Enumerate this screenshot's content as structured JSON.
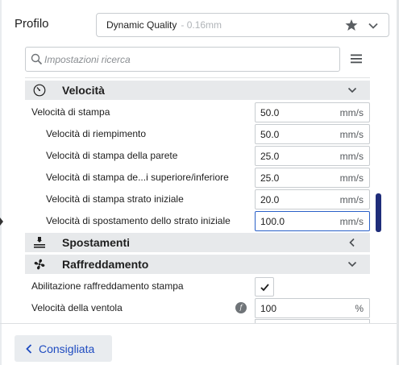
{
  "header": {
    "profile_label": "Profilo",
    "profile_name": "Dynamic Quality",
    "profile_detail": "- 0.16mm",
    "star_icon": "star-icon",
    "dropdown_icon": "chevron-down-icon"
  },
  "search": {
    "placeholder": "Impostazioni ricerca",
    "value": "",
    "menu_icon": "hamburger-menu-icon"
  },
  "categories": {
    "speed": {
      "label": "Velocità",
      "icon": "speedometer-icon",
      "state": "expanded"
    },
    "travel": {
      "label": "Spostamenti",
      "icon": "travel-icon",
      "state": "collapsed"
    },
    "cooling": {
      "label": "Raffreddamento",
      "icon": "fan-icon",
      "state": "expanded"
    }
  },
  "speed_settings": [
    {
      "label": "Velocità di stampa",
      "value": "50.0",
      "unit": "mm/s"
    },
    {
      "label": "Velocità di riempimento",
      "value": "50.0",
      "unit": "mm/s"
    },
    {
      "label": "Velocità di stampa della parete",
      "value": "25.0",
      "unit": "mm/s"
    },
    {
      "label": "Velocità di stampa de...i superiore/inferiore",
      "value": "25.0",
      "unit": "mm/s"
    },
    {
      "label": "Velocità di stampa strato iniziale",
      "value": "20.0",
      "unit": "mm/s"
    },
    {
      "label": "Velocità di spostamento dello strato iniziale",
      "value": "100.0",
      "unit": "mm/s"
    }
  ],
  "cooling_settings": {
    "enable_label": "Abilitazione raffreddamento stampa",
    "enable_checked": true,
    "fan_label": "Velocità della ventola",
    "fan_value": "100",
    "fan_unit": "%",
    "fan_badge": "f"
  },
  "footer": {
    "recommended_label": "Consigliata"
  },
  "colors": {
    "accent": "#1e4bc0",
    "focus_border": "#2a60c8",
    "scrollbar": "#1f2d7a",
    "category_bg": "#e7e9eb"
  }
}
